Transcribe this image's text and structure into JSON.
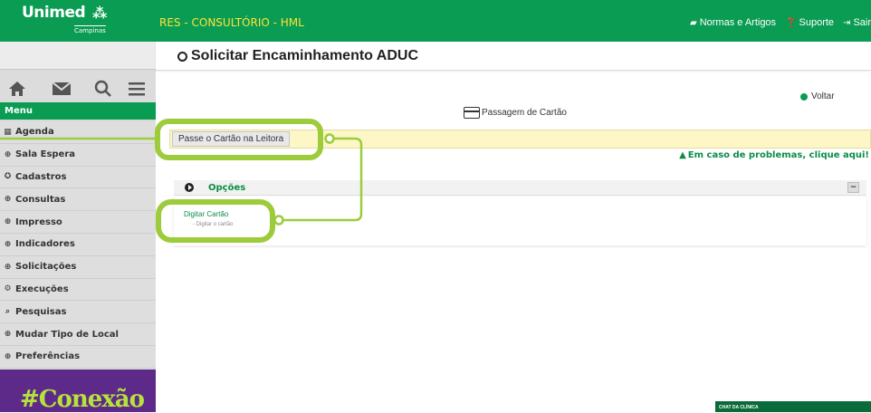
{
  "header": {
    "logo_name": "Unimed",
    "logo_city": "Campinas",
    "app_title": "RES - CONSULTÓRIO - HML",
    "links": [
      {
        "label": "Normas e Artigos",
        "icon": "book-icon"
      },
      {
        "label": "Suporte",
        "icon": "help-icon"
      },
      {
        "label": "Sair",
        "icon": "logout-icon"
      }
    ]
  },
  "sidebar": {
    "icons": [
      "home-icon",
      "mail-icon",
      "search-icon",
      "menu-icon"
    ],
    "menu_title": "Menu",
    "items": [
      {
        "label": "Agenda",
        "glyph": "▦"
      },
      {
        "label": "Sala Espera",
        "glyph": "⊕"
      },
      {
        "label": "Cadastros",
        "glyph": "✪"
      },
      {
        "label": "Consultas",
        "glyph": "⊕"
      },
      {
        "label": "Impresso",
        "glyph": "⊕"
      },
      {
        "label": "Indicadores",
        "glyph": "⊕"
      },
      {
        "label": "Solicitações",
        "glyph": "⊕"
      },
      {
        "label": "Execuções",
        "glyph": "⚙"
      },
      {
        "label": "Pesquisas",
        "glyph": "⌕"
      },
      {
        "label": "Mudar Tipo de Local",
        "glyph": "⊕"
      },
      {
        "label": "Preferências",
        "glyph": "⊕"
      }
    ],
    "banner_text": "#Conexão"
  },
  "main": {
    "page_title": "Solicitar Encaminhamento ADUC",
    "back_link": "Voltar",
    "card_section_label": "Passagem de Cartão",
    "reader_button": "Passe o Cartão na Leitora",
    "problem_link": "Em caso de problemas, clique aqui!",
    "options_title": "Opções",
    "collapse_symbol": "−",
    "option_item_title": "Digitar Cartão",
    "option_item_subtitle": "- Digitar o cartão",
    "chat_label": "CHAT DA CLÍNICA"
  },
  "colors": {
    "brand_green": "#0a9c52",
    "title_yellow": "#ffe23a",
    "highlight_lime": "#9ccc3c",
    "banner_purple": "#5d2a8a"
  }
}
